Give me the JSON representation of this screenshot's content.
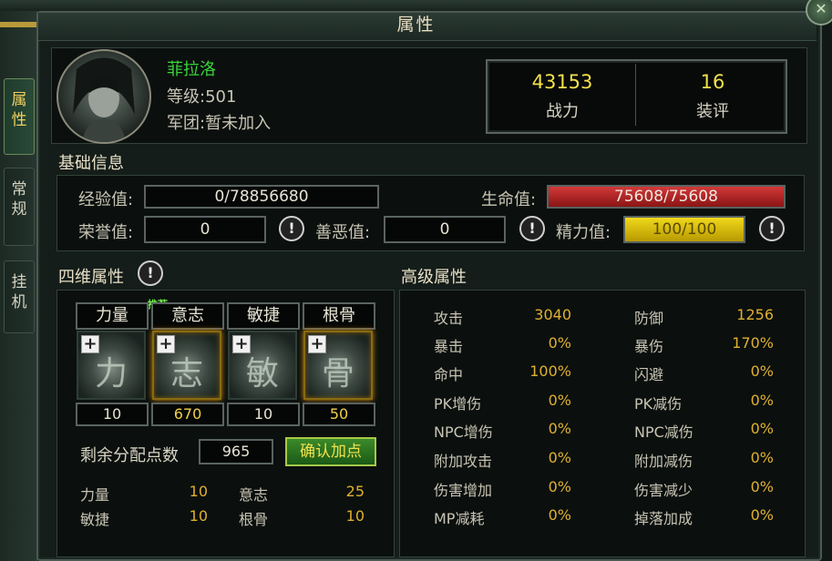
{
  "window": {
    "title": "属性"
  },
  "side_tabs": [
    {
      "label": "属性",
      "active": true
    },
    {
      "label": "常规",
      "active": false
    },
    {
      "label": "挂机",
      "active": false
    }
  ],
  "character": {
    "name": "菲拉洛",
    "level": "等级:501",
    "legion": "军团:暂未加入"
  },
  "stats": {
    "power_value": "43153",
    "power_label": "战力",
    "gear_value": "16",
    "gear_label": "装评"
  },
  "basic": {
    "heading": "基础信息",
    "exp_label": "经验值:",
    "exp_value": "0/78856680",
    "hp_label": "生命值:",
    "hp_value": "75608/75608",
    "honor_label": "荣誉值:",
    "honor_value": "0",
    "karma_label": "善恶值:",
    "karma_value": "0",
    "energy_label": "精力值:",
    "energy_value": "100/100"
  },
  "four": {
    "heading": "四维属性",
    "recommend": "推荐",
    "dims": [
      {
        "name": "力量",
        "value": "10",
        "icon": "strength-rune-icon",
        "glyph": "力",
        "highlight": false
      },
      {
        "name": "意志",
        "value": "670",
        "icon": "will-rune-icon",
        "glyph": "志",
        "highlight": true
      },
      {
        "name": "敏捷",
        "value": "10",
        "icon": "agility-rune-icon",
        "glyph": "敏",
        "highlight": false
      },
      {
        "name": "根骨",
        "value": "50",
        "icon": "constitution-rune-icon",
        "glyph": "骨",
        "highlight": true
      }
    ],
    "remaining_label": "剩余分配点数",
    "remaining_value": "965",
    "confirm_label": "确认加点",
    "summary": [
      {
        "label": "力量",
        "value": "10"
      },
      {
        "label": "意志",
        "value": "25"
      },
      {
        "label": "敏捷",
        "value": "10"
      },
      {
        "label": "根骨",
        "value": "10"
      }
    ]
  },
  "advanced": {
    "heading": "高级属性",
    "rows": [
      {
        "l1": "攻击",
        "v1": "3040",
        "l2": "防御",
        "v2": "1256"
      },
      {
        "l1": "暴击",
        "v1": "0%",
        "l2": "暴伤",
        "v2": "170%"
      },
      {
        "l1": "命中",
        "v1": "100%",
        "l2": "闪避",
        "v2": "0%"
      },
      {
        "l1": "PK增伤",
        "v1": "0%",
        "l2": "PK减伤",
        "v2": "0%"
      },
      {
        "l1": "NPC增伤",
        "v1": "0%",
        "l2": "NPC减伤",
        "v2": "0%"
      },
      {
        "l1": "附加攻击",
        "v1": "0%",
        "l2": "附加减伤",
        "v2": "0%"
      },
      {
        "l1": "伤害增加",
        "v1": "0%",
        "l2": "伤害减少",
        "v2": "0%"
      },
      {
        "l1": "MP减耗",
        "v1": "0%",
        "l2": "掉落加成",
        "v2": "0%"
      }
    ]
  },
  "icons": {
    "close": "close-icon",
    "info": "info-icon",
    "plus": "plus-icon"
  },
  "colors": {
    "name": "#39d43a",
    "power": "#f2e04a",
    "value": "#e0b030",
    "hp": "#d23838",
    "energy": "#f0d81c"
  }
}
